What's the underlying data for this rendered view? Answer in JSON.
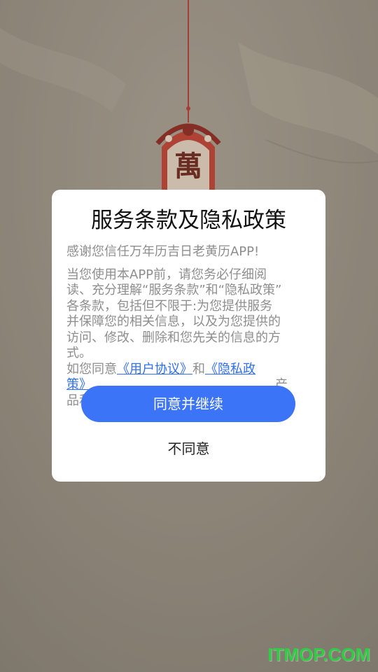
{
  "background": {
    "lantern_char": "萬"
  },
  "dialog": {
    "title": "服务条款及隐私政策",
    "thanks": "感谢您信任万年历吉日老黄历APP!",
    "body_lines": [
      "当您使用本APP前，请您务必仔细阅",
      "读、充分理解“服务条款”和“隐私政策”",
      "各条款，包括但不限于:为您提供服务",
      "并保障您的相关信息，以及为您提供的",
      "访问、修改、删除和您先关的信息的方",
      "式。"
    ],
    "consent_prefix": "如您同意",
    "user_agreement_link": "《用户协议》",
    "consent_and": "和",
    "privacy_link_part1": "《隐私政",
    "privacy_link_part2": "策》",
    "hidden_line_tail": "产",
    "hidden_line_start": "品和",
    "agree_button": "同意并继续",
    "disagree_button": "不同意"
  },
  "watermark": "ITMOP.COM",
  "colors": {
    "accent": "#3c74f8",
    "link": "#2f6ef5",
    "watermark": "#2fcc46",
    "lantern": "#c0392b"
  }
}
